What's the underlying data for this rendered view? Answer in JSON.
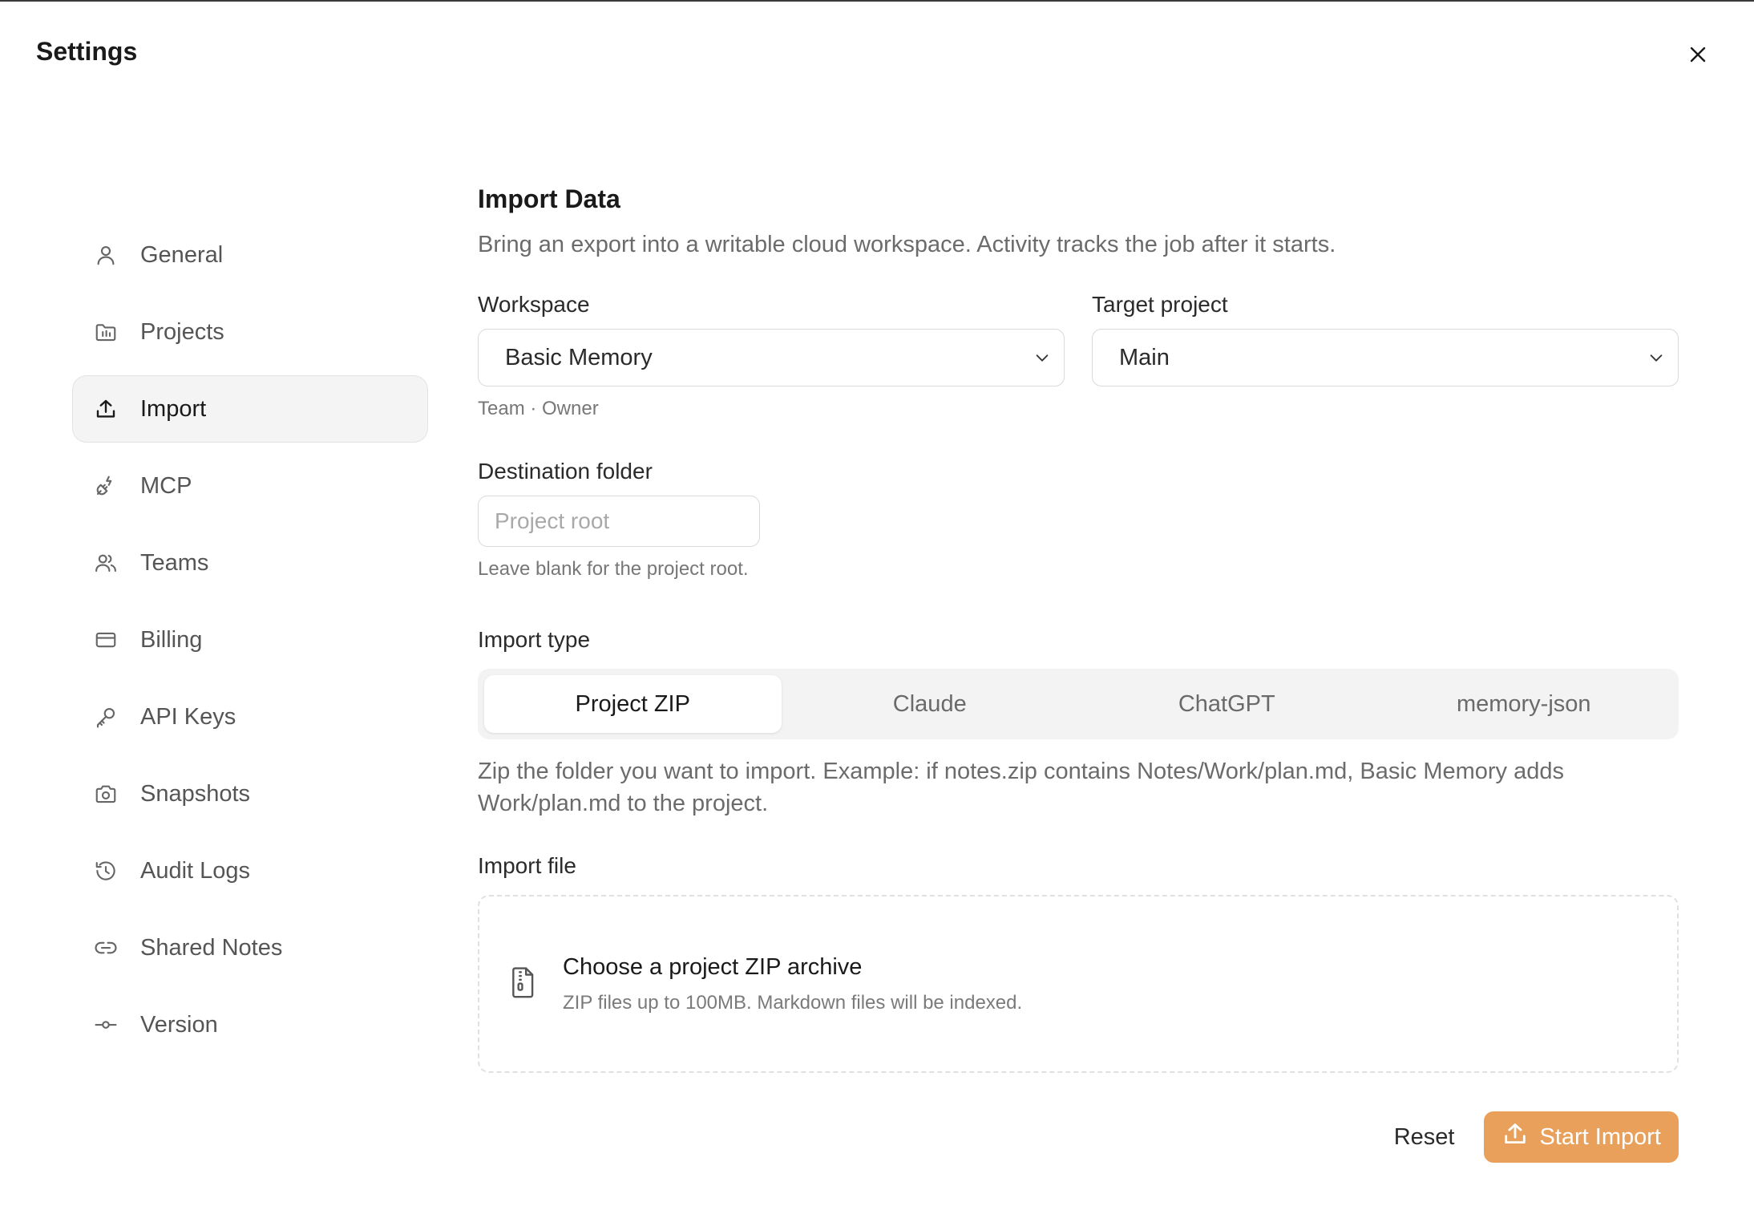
{
  "window": {
    "title": "Settings"
  },
  "sidebar": {
    "items": [
      {
        "label": "General",
        "icon": "user-icon",
        "active": false
      },
      {
        "label": "Projects",
        "icon": "folder-chart-icon",
        "active": false
      },
      {
        "label": "Import",
        "icon": "upload-icon",
        "active": true
      },
      {
        "label": "MCP",
        "icon": "plug-icon",
        "active": false
      },
      {
        "label": "Teams",
        "icon": "users-icon",
        "active": false
      },
      {
        "label": "Billing",
        "icon": "credit-card-icon",
        "active": false
      },
      {
        "label": "API Keys",
        "icon": "key-icon",
        "active": false
      },
      {
        "label": "Snapshots",
        "icon": "camera-icon",
        "active": false
      },
      {
        "label": "Audit Logs",
        "icon": "history-icon",
        "active": false
      },
      {
        "label": "Shared Notes",
        "icon": "link-icon",
        "active": false
      },
      {
        "label": "Version",
        "icon": "commit-icon",
        "active": false
      }
    ]
  },
  "main": {
    "title": "Import Data",
    "description": "Bring an export into a writable cloud workspace. Activity tracks the job after it starts.",
    "workspace": {
      "label": "Workspace",
      "value": "Basic Memory",
      "help": "Team · Owner"
    },
    "target_project": {
      "label": "Target project",
      "value": "Main"
    },
    "destination": {
      "label": "Destination folder",
      "placeholder": "Project root",
      "value": "",
      "help": "Leave blank for the project root."
    },
    "import_type": {
      "label": "Import type",
      "options": [
        "Project ZIP",
        "Claude",
        "ChatGPT",
        "memory-json"
      ],
      "selected": "Project ZIP",
      "help": "Zip the folder you want to import. Example: if notes.zip contains Notes/Work/plan.md, Basic Memory adds Work/plan.md to the project."
    },
    "import_file": {
      "label": "Import file",
      "title": "Choose a project ZIP archive",
      "subtitle": "ZIP files up to 100MB. Markdown files will be indexed."
    },
    "actions": {
      "reset": "Reset",
      "start": "Start Import"
    }
  },
  "colors": {
    "accent": "#e9a05a",
    "active_bg": "#f4f4f4",
    "segment_bg": "#f3f3f3"
  }
}
